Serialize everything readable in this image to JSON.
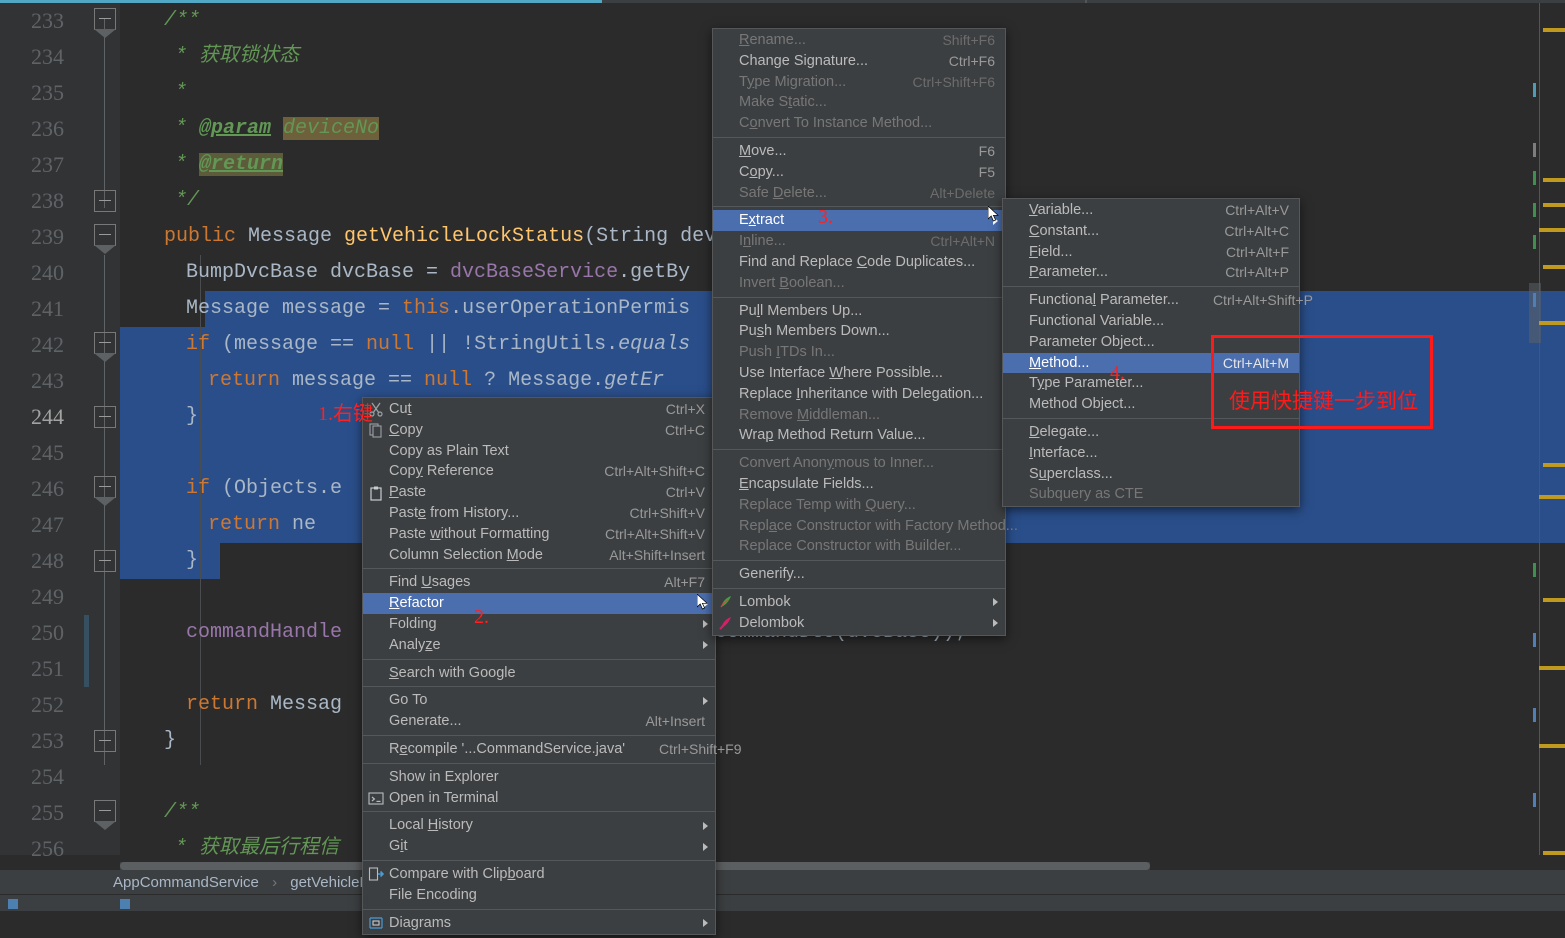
{
  "editor": {
    "first_line": 233,
    "lines": [
      {
        "n": 233,
        "indent": 4,
        "segs": [
          {
            "t": "/**",
            "c": "cmt"
          }
        ]
      },
      {
        "n": 234,
        "indent": 5,
        "segs": [
          {
            "t": "* 获取锁状态",
            "c": "cmt"
          }
        ]
      },
      {
        "n": 235,
        "indent": 5,
        "segs": [
          {
            "t": "*",
            "c": "cmt"
          }
        ]
      },
      {
        "n": 236,
        "indent": 5,
        "segs": [
          {
            "t": "* ",
            "c": "cmt"
          },
          {
            "t": "@param",
            "c": "cmtb"
          },
          {
            "t": " ",
            "c": "cmt"
          },
          {
            "t": "deviceNo",
            "c": "cmt hl1"
          }
        ]
      },
      {
        "n": 237,
        "indent": 5,
        "segs": [
          {
            "t": "* ",
            "c": "cmt"
          },
          {
            "t": "@return",
            "c": "cmtb hl2"
          }
        ]
      },
      {
        "n": 238,
        "indent": 5,
        "segs": [
          {
            "t": "*/",
            "c": "cmt"
          }
        ]
      },
      {
        "n": 239,
        "indent": 4,
        "segs": [
          {
            "t": "public ",
            "c": "kw"
          },
          {
            "t": "Message ",
            "c": "typ"
          },
          {
            "t": "getVehicleLockStatus",
            "c": "fn"
          },
          {
            "t": "(String dev",
            "c": "typ"
          }
        ]
      },
      {
        "n": 240,
        "indent": 6,
        "segs": [
          {
            "t": "BumpDvcBase dvcBase = ",
            "c": "typ"
          },
          {
            "t": "dvcBaseService",
            "c": "fld"
          },
          {
            "t": ".getBy",
            "c": "typ"
          }
        ]
      },
      {
        "n": 241,
        "indent": 6,
        "segs": [
          {
            "t": "Message message = ",
            "c": "typ"
          },
          {
            "t": "this",
            "c": "kw"
          },
          {
            "t": ".userOperationPermis",
            "c": "typ"
          }
        ]
      },
      {
        "n": 242,
        "indent": 6,
        "segs": [
          {
            "t": "if",
            "c": "kw"
          },
          {
            "t": " (message == ",
            "c": "typ"
          },
          {
            "t": "null",
            "c": "kw"
          },
          {
            "t": " || !StringUtils.",
            "c": "typ"
          },
          {
            "t": "equals",
            "c": "typ ital"
          }
        ]
      },
      {
        "n": 243,
        "indent": 8,
        "segs": [
          {
            "t": "return",
            "c": "kw"
          },
          {
            "t": " message == ",
            "c": "typ"
          },
          {
            "t": "null",
            "c": "kw"
          },
          {
            "t": " ? Message.",
            "c": "typ"
          },
          {
            "t": "getEr",
            "c": "typ ital"
          }
        ]
      },
      {
        "n": 244,
        "indent": 6,
        "segs": [
          {
            "t": "}",
            "c": "typ"
          }
        ],
        "current": true
      },
      {
        "n": 245,
        "indent": 0,
        "segs": []
      },
      {
        "n": 246,
        "indent": 6,
        "segs": [
          {
            "t": "if",
            "c": "kw"
          },
          {
            "t": " (Objects.e",
            "c": "typ"
          }
        ]
      },
      {
        "n": 247,
        "indent": 8,
        "segs": [
          {
            "t": "return",
            "c": "kw"
          },
          {
            "t": " ne",
            "c": "typ"
          }
        ]
      },
      {
        "n": 248,
        "indent": 6,
        "segs": [
          {
            "t": "}",
            "c": "typ"
          }
        ]
      },
      {
        "n": 249,
        "indent": 0,
        "segs": []
      },
      {
        "n": 250,
        "indent": 6,
        "segs": [
          {
            "t": "commandHandle",
            "c": "fld"
          }
        ]
      },
      {
        "n": 251,
        "indent": 0,
        "segs": []
      },
      {
        "n": 252,
        "indent": 6,
        "segs": [
          {
            "t": "return",
            "c": "kw"
          },
          {
            "t": " Messag",
            "c": "typ"
          }
        ]
      },
      {
        "n": 253,
        "indent": 4,
        "segs": [
          {
            "t": "}",
            "c": "typ"
          }
        ]
      },
      {
        "n": 254,
        "indent": 0,
        "segs": []
      },
      {
        "n": 255,
        "indent": 4,
        "segs": [
          {
            "t": "/**",
            "c": "cmt"
          }
        ]
      },
      {
        "n": 256,
        "indent": 5,
        "segs": [
          {
            "t": "* 获取最后行程信",
            "c": "cmt"
          }
        ]
      }
    ],
    "tail_code": "CommandDto(dvcBase));"
  },
  "breadcrumb": {
    "class_name": "AppCommandService",
    "separator": "›",
    "method_name": "getVehicleLockSt"
  },
  "context_menu": {
    "items": [
      {
        "label": "Cut",
        "accel": "t",
        "shortcut": "Ctrl+X",
        "icon": "cut-icon"
      },
      {
        "label": "Copy",
        "accel": "C",
        "shortcut": "Ctrl+C",
        "icon": "copy-icon"
      },
      {
        "label": "Copy as Plain Text",
        "shortcut": ""
      },
      {
        "label": "Copy Reference",
        "accel": "y",
        "shortcut": "Ctrl+Alt+Shift+C"
      },
      {
        "label": "Paste",
        "accel": "P",
        "shortcut": "Ctrl+V",
        "icon": "paste-icon"
      },
      {
        "label": "Paste from History...",
        "accel": "e",
        "shortcut": "Ctrl+Shift+V"
      },
      {
        "label": "Paste without Formatting",
        "accel": "w",
        "shortcut": "Ctrl+Alt+Shift+V"
      },
      {
        "label": "Column Selection Mode",
        "accel": "M",
        "shortcut": "Alt+Shift+Insert"
      },
      {
        "sep": true
      },
      {
        "label": "Find Usages",
        "accel": "U",
        "shortcut": "Alt+F7"
      },
      {
        "label": "Refactor",
        "accel": "R",
        "shortcut": "",
        "selected": true,
        "submenu": true
      },
      {
        "label": "Folding",
        "shortcut": "",
        "submenu": true
      },
      {
        "label": "Analyze",
        "accel": "z",
        "shortcut": "",
        "submenu": true
      },
      {
        "sep": true
      },
      {
        "label": "Search with Google",
        "accel": "S",
        "shortcut": ""
      },
      {
        "sep": true
      },
      {
        "label": "Go To",
        "shortcut": "",
        "submenu": true
      },
      {
        "label": "Generate...",
        "shortcut": "Alt+Insert"
      },
      {
        "sep": true
      },
      {
        "label": "Recompile '...CommandService.java'",
        "accel": "e",
        "shortcut": "Ctrl+Shift+F9"
      },
      {
        "sep": true
      },
      {
        "label": "Show in Explorer",
        "shortcut": ""
      },
      {
        "label": "Open in Terminal",
        "shortcut": "",
        "icon": "terminal-icon"
      },
      {
        "sep": true
      },
      {
        "label": "Local History",
        "accel": "H",
        "shortcut": "",
        "submenu": true
      },
      {
        "label": "Git",
        "accel": "i",
        "shortcut": "",
        "submenu": true
      },
      {
        "sep": true
      },
      {
        "label": "Compare with Clipboard",
        "accel": "b",
        "shortcut": "",
        "icon": "compare-icon"
      },
      {
        "label": "File Encoding",
        "shortcut": ""
      },
      {
        "sep": true
      },
      {
        "label": "Diagrams",
        "shortcut": "",
        "submenu": true,
        "icon": "diagram-icon"
      }
    ]
  },
  "refactor_menu": {
    "items": [
      {
        "label": "Rename...",
        "accel": "R",
        "shortcut": "Shift+F6",
        "disabled": true
      },
      {
        "label": "Change Signature...",
        "accel": "g",
        "shortcut": "Ctrl+F6"
      },
      {
        "label": "Type Migration...",
        "accel": "y",
        "shortcut": "Ctrl+Shift+F6",
        "disabled": true
      },
      {
        "label": "Make Static...",
        "accel": "t",
        "shortcut": "",
        "disabled": true
      },
      {
        "label": "Convert To Instance Method...",
        "accel": "o",
        "shortcut": "",
        "disabled": true
      },
      {
        "sep": true
      },
      {
        "label": "Move...",
        "accel": "M",
        "shortcut": "F6"
      },
      {
        "label": "Copy...",
        "accel": "o",
        "shortcut": "F5"
      },
      {
        "label": "Safe Delete...",
        "accel": "D",
        "shortcut": "Alt+Delete",
        "disabled": true
      },
      {
        "sep": true
      },
      {
        "label": "Extract",
        "accel": "x",
        "shortcut": "",
        "selected": true,
        "submenu": true
      },
      {
        "label": "Inline...",
        "accel": "n",
        "shortcut": "Ctrl+Alt+N",
        "disabled": true
      },
      {
        "label": "Find and Replace Code Duplicates...",
        "accel": "C",
        "shortcut": ""
      },
      {
        "label": "Invert Boolean...",
        "accel": "B",
        "shortcut": "",
        "disabled": true
      },
      {
        "sep": true
      },
      {
        "label": "Pull Members Up...",
        "accel": "l",
        "shortcut": ""
      },
      {
        "label": "Push Members Down...",
        "accel": "s",
        "shortcut": ""
      },
      {
        "label": "Push ITDs In...",
        "accel": "I",
        "shortcut": "",
        "disabled": true
      },
      {
        "label": "Use Interface Where Possible...",
        "accel": "W",
        "shortcut": ""
      },
      {
        "label": "Replace Inheritance with Delegation...",
        "accel": "I",
        "shortcut": ""
      },
      {
        "label": "Remove Middleman...",
        "accel": "M",
        "shortcut": "",
        "disabled": true
      },
      {
        "label": "Wrap Method Return Value...",
        "accel": "p",
        "shortcut": ""
      },
      {
        "sep": true
      },
      {
        "label": "Convert Anonymous to Inner...",
        "accel": "y",
        "shortcut": "",
        "disabled": true
      },
      {
        "label": "Encapsulate Fields...",
        "accel": "E",
        "shortcut": ""
      },
      {
        "label": "Replace Temp with Query...",
        "accel": "Q",
        "shortcut": "",
        "disabled": true
      },
      {
        "label": "Replace Constructor with Factory Method...",
        "accel": "a",
        "shortcut": "",
        "disabled": true
      },
      {
        "label": "Replace Constructor with Builder...",
        "shortcut": "",
        "disabled": true
      },
      {
        "sep": true
      },
      {
        "label": "Generify...",
        "shortcut": ""
      },
      {
        "sep": true
      },
      {
        "label": "Lombok",
        "shortcut": "",
        "submenu": true,
        "icon": "lombok-icon"
      },
      {
        "label": "Delombok",
        "shortcut": "",
        "submenu": true,
        "icon": "delombok-icon"
      }
    ]
  },
  "extract_menu": {
    "items": [
      {
        "label": "Variable...",
        "accel": "V",
        "shortcut": "Ctrl+Alt+V"
      },
      {
        "label": "Constant...",
        "accel": "C",
        "shortcut": "Ctrl+Alt+C"
      },
      {
        "label": "Field...",
        "accel": "F",
        "shortcut": "Ctrl+Alt+F"
      },
      {
        "label": "Parameter...",
        "accel": "P",
        "shortcut": "Ctrl+Alt+P"
      },
      {
        "sep": true
      },
      {
        "label": "Functional Parameter...",
        "accel": "l",
        "shortcut": "Ctrl+Alt+Shift+P"
      },
      {
        "label": "Functional Variable...",
        "shortcut": ""
      },
      {
        "label": "Parameter Object...",
        "shortcut": ""
      },
      {
        "label": "Method...",
        "accel": "M",
        "shortcut": "Ctrl+Alt+M",
        "selected": true
      },
      {
        "label": "Type Parameter...",
        "accel": "y",
        "shortcut": ""
      },
      {
        "label": "Method Object...",
        "shortcut": ""
      },
      {
        "sep": true
      },
      {
        "label": "Delegate...",
        "accel": "D",
        "shortcut": ""
      },
      {
        "label": "Interface...",
        "accel": "I",
        "shortcut": ""
      },
      {
        "label": "Superclass...",
        "accel": "u",
        "shortcut": ""
      },
      {
        "label": "Subquery as CTE",
        "shortcut": "",
        "disabled": true
      }
    ]
  },
  "annotations": {
    "step1": "1.右键",
    "step2": "2.",
    "step3": "3.",
    "step4": "4.",
    "note": "使用快捷键一步到位",
    "accent_color": "#ff1a1a"
  },
  "colors": {
    "editor_bg": "#2b2b2b",
    "gutter_bg": "#313335",
    "selection": "#2a4e8a",
    "menu_bg": "#3c3f41",
    "menu_highlight": "#4b6eaf",
    "progress": "#52a7c4",
    "warning_marker": "#bf9a1f"
  }
}
